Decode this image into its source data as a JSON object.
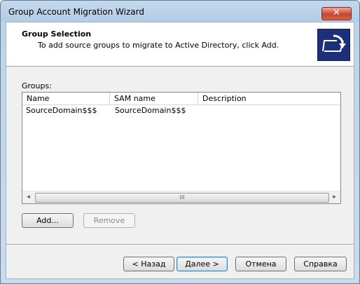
{
  "window": {
    "title": "Group Account Migration Wizard",
    "close_glyph": "✕"
  },
  "header": {
    "title": "Group Selection",
    "subtitle": "To add source groups to migrate to Active Directory, click Add.",
    "icon": "migration-arrow-icon"
  },
  "groups": {
    "label": "Groups:",
    "columns": [
      "Name",
      "SAM name",
      "Description"
    ],
    "rows": [
      {
        "name": "SourceDomain$$$",
        "sam_name": "SourceDomain$$$",
        "description": ""
      }
    ],
    "scroll_grip": "III"
  },
  "buttons": {
    "add": "Add...",
    "remove": "Remove",
    "back": "< Назад",
    "next": "Далее >",
    "cancel": "Отмена",
    "help": "Справка"
  },
  "colors": {
    "title_bar": "#bcd3ea",
    "close_button": "#c7432c",
    "header_icon_bg": "#1e2f7a"
  }
}
